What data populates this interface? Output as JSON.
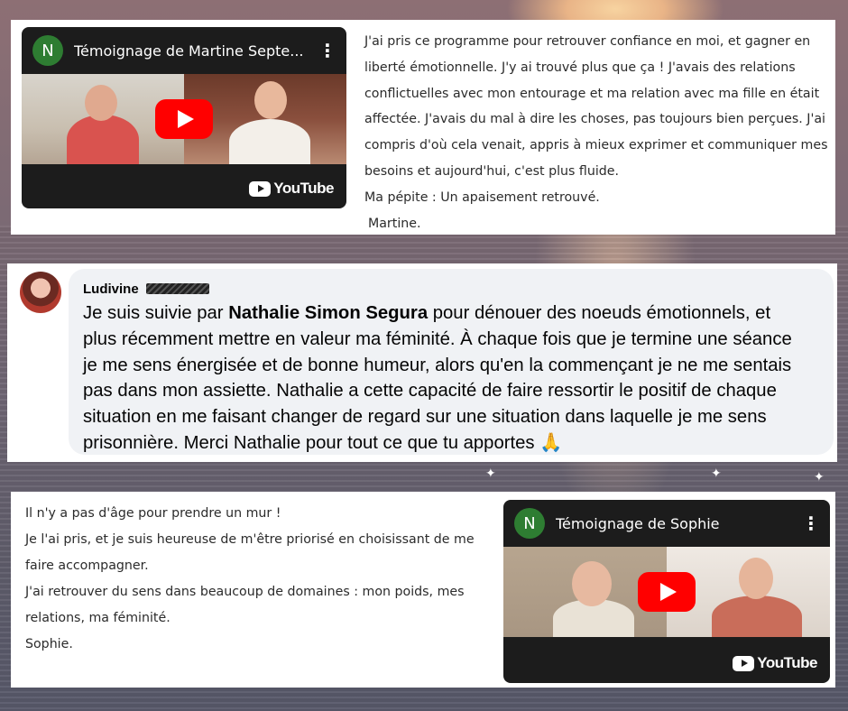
{
  "card1": {
    "video": {
      "channel_initial": "N",
      "title": "Témoignage de Martine Septe...",
      "menu_glyph": "⋮",
      "brand": "YouTube"
    },
    "lines": [
      "J'ai pris ce programme pour retrouver confiance en moi, et gagner en",
      "liberté émotionnelle. J'y ai trouvé plus que ça ! J'avais des relations",
      "conflictuelles avec mon entourage et ma relation avec ma fille en était",
      "affectée. J'avais du mal à dire les choses, pas toujours bien perçues. J'ai",
      "compris d'où cela venait, appris à mieux exprimer et communiquer mes",
      "besoins et aujourd'hui, c'est plus fluide.",
      "Ma pépite : Un apaisement retrouvé."
    ],
    "signature": "Martine."
  },
  "card2": {
    "author": "Ludivine",
    "intro": "Je suis suivie par ",
    "highlight": "Nathalie Simon Segura",
    "after_highlight": " pour dénouer des noeuds émotionnels, et",
    "lines": [
      "plus récemment mettre en valeur ma féminité. À chaque fois que je termine une séance",
      "je me sens énergisée et de bonne humeur, alors qu'en la commençant je ne me sentais",
      "pas dans mon assiette. Nathalie a cette capacité de faire ressortir le positif de chaque",
      "situation en me faisant changer de regard sur une situation dans laquelle je me sens",
      "prisonnière. Merci Nathalie pour tout ce que tu apportes 🙏"
    ]
  },
  "card3": {
    "lines": [
      "Il n'y a pas d'âge pour prendre un mur !",
      "Je l'ai pris, et je suis heureuse de m'être priorisé en choisissant de me",
      "faire accompagner.",
      "J'ai retrouver du sens dans beaucoup de domaines : mon poids, mes",
      "relations, ma féminité.",
      "Sophie."
    ],
    "video": {
      "channel_initial": "N",
      "title": "Témoignage de Sophie",
      "menu_glyph": "⋮",
      "brand": "YouTube"
    }
  },
  "colors": {
    "channel_avatar": "#2e7d32",
    "play_button": "#ff0000",
    "comment_bubble": "#f0f2f5"
  }
}
